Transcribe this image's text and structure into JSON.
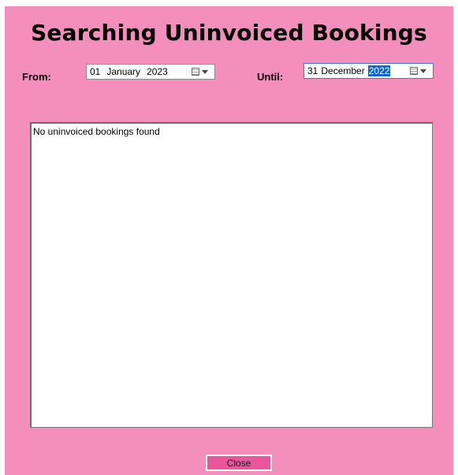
{
  "window": {
    "title": "Searching Uninvoiced Bookings",
    "background_color": "#f48fbd"
  },
  "filters": {
    "from": {
      "label": "From:",
      "day": "01",
      "month": "January",
      "year": "2023",
      "icon": "calendar-dropdown-icon"
    },
    "until": {
      "label": "Until:",
      "day": "31",
      "month": "December",
      "year": "2022",
      "selected_part": "year",
      "selection_color": "#0a64d4",
      "icon": "calendar-dropdown-icon"
    }
  },
  "results": {
    "message": "No uninvoiced bookings found"
  },
  "footer": {
    "close_label": "Close",
    "close_color": "#e8579e"
  }
}
